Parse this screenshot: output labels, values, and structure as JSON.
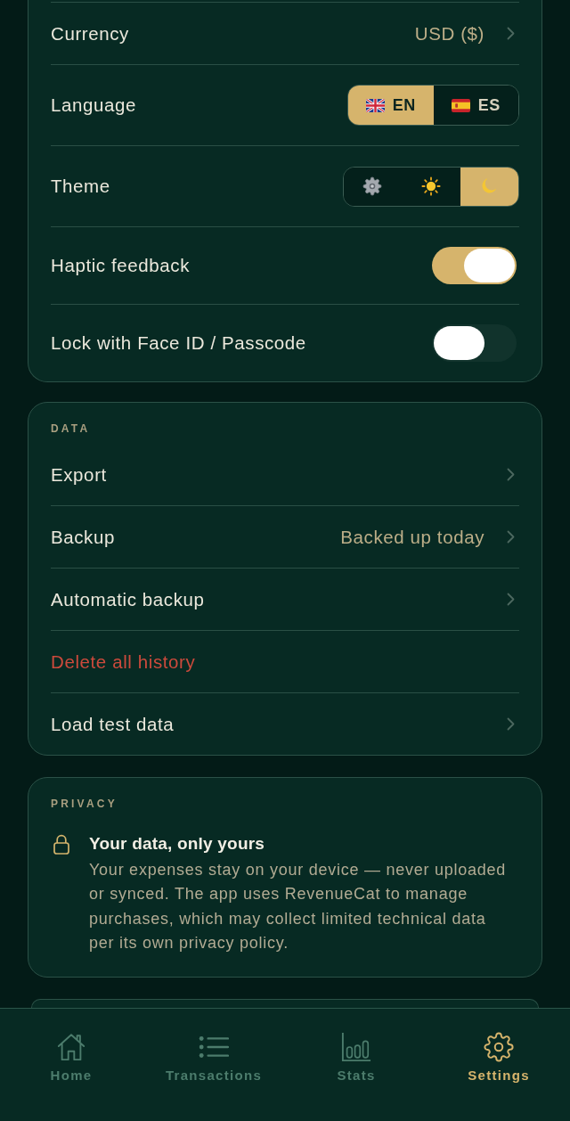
{
  "preferences": {
    "rows": [
      {
        "kind": "link",
        "label": "Currency",
        "value": "USD ($)"
      },
      {
        "kind": "segmented",
        "label": "Language",
        "options": [
          {
            "kind": "uk",
            "text": "EN",
            "selected": true
          },
          {
            "kind": "spain",
            "text": "ES",
            "selected": false
          }
        ]
      },
      {
        "kind": "segmented",
        "label": "Theme",
        "options": [
          {
            "kind": "system",
            "selected": false
          },
          {
            "kind": "light",
            "selected": false
          },
          {
            "kind": "dark",
            "selected": true
          }
        ]
      },
      {
        "kind": "toggle",
        "label": "Haptic feedback",
        "on": true
      },
      {
        "kind": "toggle",
        "label": "Lock with Face ID / Passcode",
        "on": false
      }
    ]
  },
  "data_section": {
    "title": "DATA",
    "rows": [
      {
        "kind": "link",
        "label": "Export"
      },
      {
        "kind": "link",
        "label": "Backup",
        "value": "Backed up today"
      },
      {
        "kind": "link",
        "label": "Automatic backup"
      },
      {
        "kind": "danger",
        "label": "Delete all history"
      },
      {
        "kind": "link",
        "label": "Load test data"
      }
    ]
  },
  "privacy": {
    "title": "PRIVACY",
    "heading": "Your data, only yours",
    "body": "Your expenses stay on your device — never uploaded or synced. The app uses RevenueCat to manage purchases, which may collect limited technical data per its own privacy policy."
  },
  "tab_bar": {
    "tabs": [
      {
        "kind": "home",
        "label": "Home",
        "selected": false
      },
      {
        "kind": "list",
        "label": "Transactions",
        "selected": false
      },
      {
        "kind": "stats",
        "label": "Stats",
        "selected": false
      },
      {
        "kind": "settings",
        "label": "Settings",
        "selected": true
      }
    ]
  }
}
